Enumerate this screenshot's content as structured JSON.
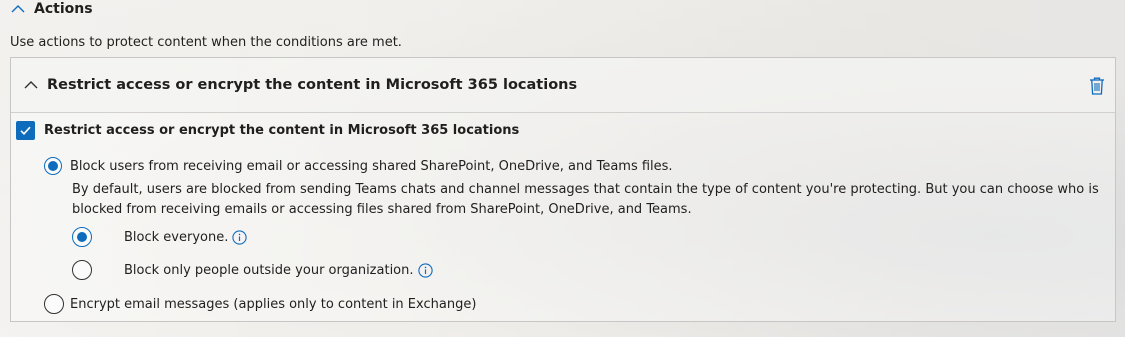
{
  "actions": {
    "title": "Actions",
    "description": "Use actions to protect content when the conditions are met."
  },
  "card": {
    "title": "Restrict access or encrypt the content in Microsoft 365 locations",
    "checkbox_label": "Restrict access or encrypt the content in Microsoft 365 locations",
    "checkbox_checked": true,
    "block_option_label": "Block users from receiving email or accessing shared SharePoint, OneDrive, and Teams files.",
    "block_description": "By default, users are blocked from sending Teams chats and channel messages that contain the type of content you're protecting. But you can choose who is blocked from receiving emails or accessing files shared from SharePoint, OneDrive, and Teams.",
    "block_everyone_label": "Block everyone.",
    "block_outside_label": "Block only people outside your organization.",
    "encrypt_label": "Encrypt email messages (applies only to content in Exchange)"
  },
  "colors": {
    "accent": "#0f6cbd",
    "text": "#201f1e"
  }
}
